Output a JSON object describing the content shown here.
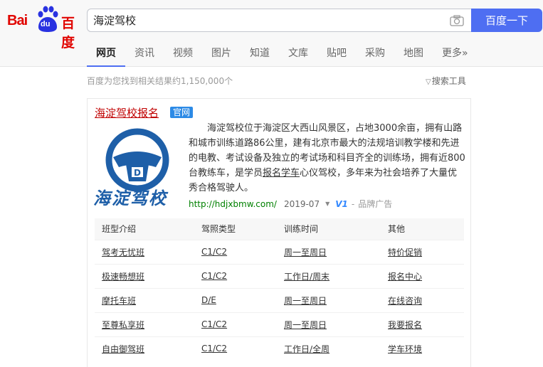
{
  "logo": {
    "left": "Bai",
    "du": "du",
    "right": "百度"
  },
  "search": {
    "query": "海淀驾校",
    "button_label": "百度一下"
  },
  "tabs": [
    {
      "label": "网页",
      "active": true
    },
    {
      "label": "资讯"
    },
    {
      "label": "视频"
    },
    {
      "label": "图片"
    },
    {
      "label": "知道"
    },
    {
      "label": "文库"
    },
    {
      "label": "贴吧"
    },
    {
      "label": "采购"
    },
    {
      "label": "地图"
    },
    {
      "label": "更多»"
    }
  ],
  "results": {
    "count_text": "百度为您找到相关结果约1,150,000个",
    "tools_label": "搜索工具"
  },
  "card": {
    "title": "海淀驾校报名",
    "badge": "官网",
    "logo_caption": "海淀驾校",
    "desc_part1": "海淀驾校位于海淀区大西山风景区，占地3000余亩，拥有山路和城市训练道路86公里，建有北京市最大的法规培训教学楼和先进的电教、考试设备及独立的考试场和科目齐全的训练场，拥有近800台教练车，是学员",
    "desc_link": "报名学车",
    "desc_part2": "心仪驾校，多年来为社会培养了大量优秀合格驾驶人。",
    "url": "http://hdjxbmw.com/",
    "date": "2019-07",
    "v_badge": "V1",
    "dash": "-",
    "ad_label": "品牌广告"
  },
  "table": {
    "headers": [
      "班型介绍",
      "驾照类型",
      "训练时间",
      "其他"
    ],
    "rows": [
      [
        "驾考无忧班",
        "C1/C2",
        "周一至周日",
        "特价促销"
      ],
      [
        "极速畅想班",
        "C1/C2",
        "工作日/周末",
        "报名中心"
      ],
      [
        "摩托车班",
        "D/E",
        "周一至周日",
        "在线咨询"
      ],
      [
        "至尊私享班",
        "C1/C2",
        "周一至周日",
        "我要报名"
      ],
      [
        "自由御驾班",
        "C1/C2",
        "工作日/全周",
        "学车环境"
      ]
    ]
  },
  "colors": {
    "brand_red": "#e10602",
    "brand_blue": "#4e6ef2",
    "url_green": "#008000",
    "title_red": "#c00000",
    "badge_blue": "#2c8ae6"
  }
}
